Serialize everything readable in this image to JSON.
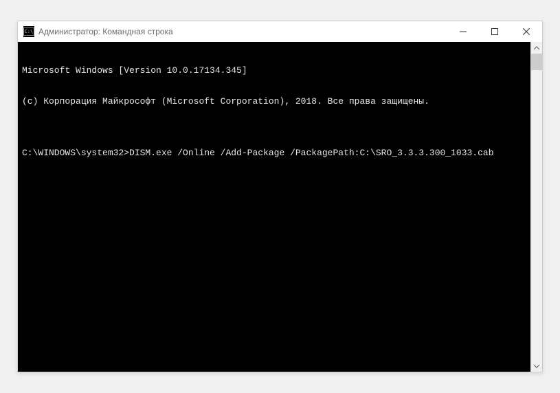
{
  "window": {
    "title": "Администратор: Командная строка"
  },
  "terminal": {
    "lines": [
      "Microsoft Windows [Version 10.0.17134.345]",
      "(c) Корпорация Майкрософт (Microsoft Corporation), 2018. Все права защищены.",
      "",
      "C:\\WINDOWS\\system32>DISM.exe /Online /Add-Package /PackagePath:C:\\SRO_3.3.3.300_1033.cab"
    ]
  }
}
